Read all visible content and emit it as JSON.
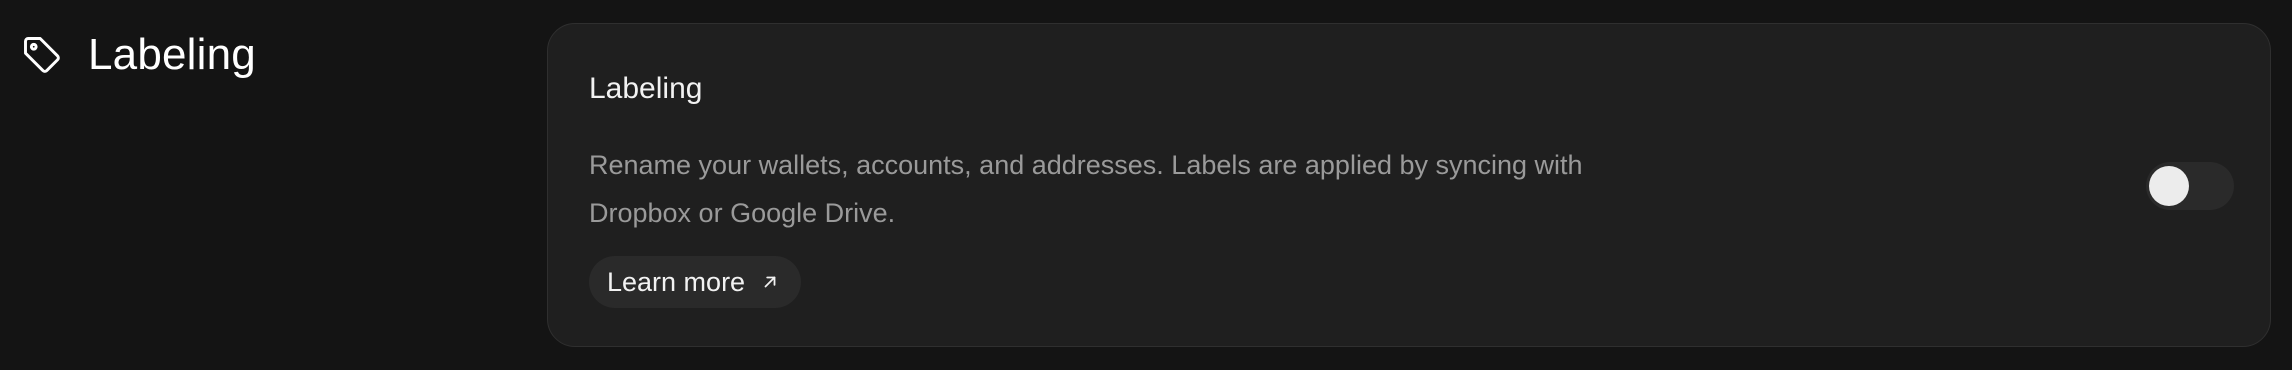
{
  "section": {
    "title": "Labeling",
    "icon": "tag-icon"
  },
  "card": {
    "title": "Labeling",
    "description": "Rename your wallets, accounts, and addresses. Labels are applied by syncing with Dropbox or Google Drive.",
    "learn_more": {
      "label": "Learn more",
      "icon": "arrow-up-right-icon"
    },
    "toggle": {
      "enabled": false
    }
  },
  "colors": {
    "background": "#141414",
    "card_background": "#1f1f1f",
    "card_border": "#2f2f2f",
    "muted_text": "#9a9a9a",
    "pill_background": "#2a2a2a"
  }
}
